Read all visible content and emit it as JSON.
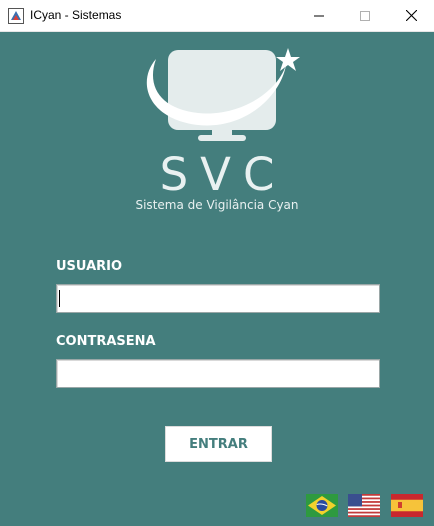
{
  "window": {
    "title": "ICyan - Sistemas",
    "controls": [
      "minimize",
      "maximize",
      "close"
    ]
  },
  "brand": {
    "name": "SVC",
    "subtitle": "Sistema de Vigilância Cyan",
    "logo_icon": "monitor-star-icon"
  },
  "form": {
    "username_label": "USUARIO",
    "username_value": "",
    "password_label": "CONTRASENA",
    "password_value": "",
    "submit_label": "ENTRAR"
  },
  "languages": [
    {
      "icon": "brazil-flag-icon"
    },
    {
      "icon": "usa-flag-icon"
    },
    {
      "icon": "spain-flag-icon"
    }
  ],
  "colors": {
    "background": "#447e7d",
    "text_light": "#ffffff",
    "button_text": "#447e7d"
  }
}
